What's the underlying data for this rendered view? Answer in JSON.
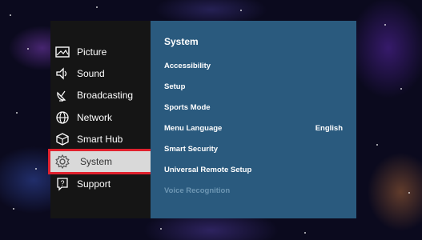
{
  "sidebar": {
    "items": [
      {
        "label": "Picture",
        "icon": "picture-icon"
      },
      {
        "label": "Sound",
        "icon": "speaker-icon"
      },
      {
        "label": "Broadcasting",
        "icon": "satellite-icon"
      },
      {
        "label": "Network",
        "icon": "globe-icon"
      },
      {
        "label": "Smart Hub",
        "icon": "cube-icon"
      },
      {
        "label": "System",
        "icon": "gear-icon",
        "selected": true
      },
      {
        "label": "Support",
        "icon": "help-icon"
      }
    ]
  },
  "panel": {
    "title": "System",
    "options": [
      {
        "label": "Accessibility"
      },
      {
        "label": "Setup"
      },
      {
        "label": "Sports Mode"
      },
      {
        "label": "Menu Language",
        "value": "English"
      },
      {
        "label": "Smart Security"
      },
      {
        "label": "Universal Remote Setup"
      },
      {
        "label": "Voice Recognition",
        "disabled": true
      }
    ]
  },
  "colors": {
    "sidebar_bg": "#151515",
    "panel_bg": "#2a5a7e",
    "selection_outline": "#e0212e",
    "disabled_text": "#6d96b3"
  }
}
